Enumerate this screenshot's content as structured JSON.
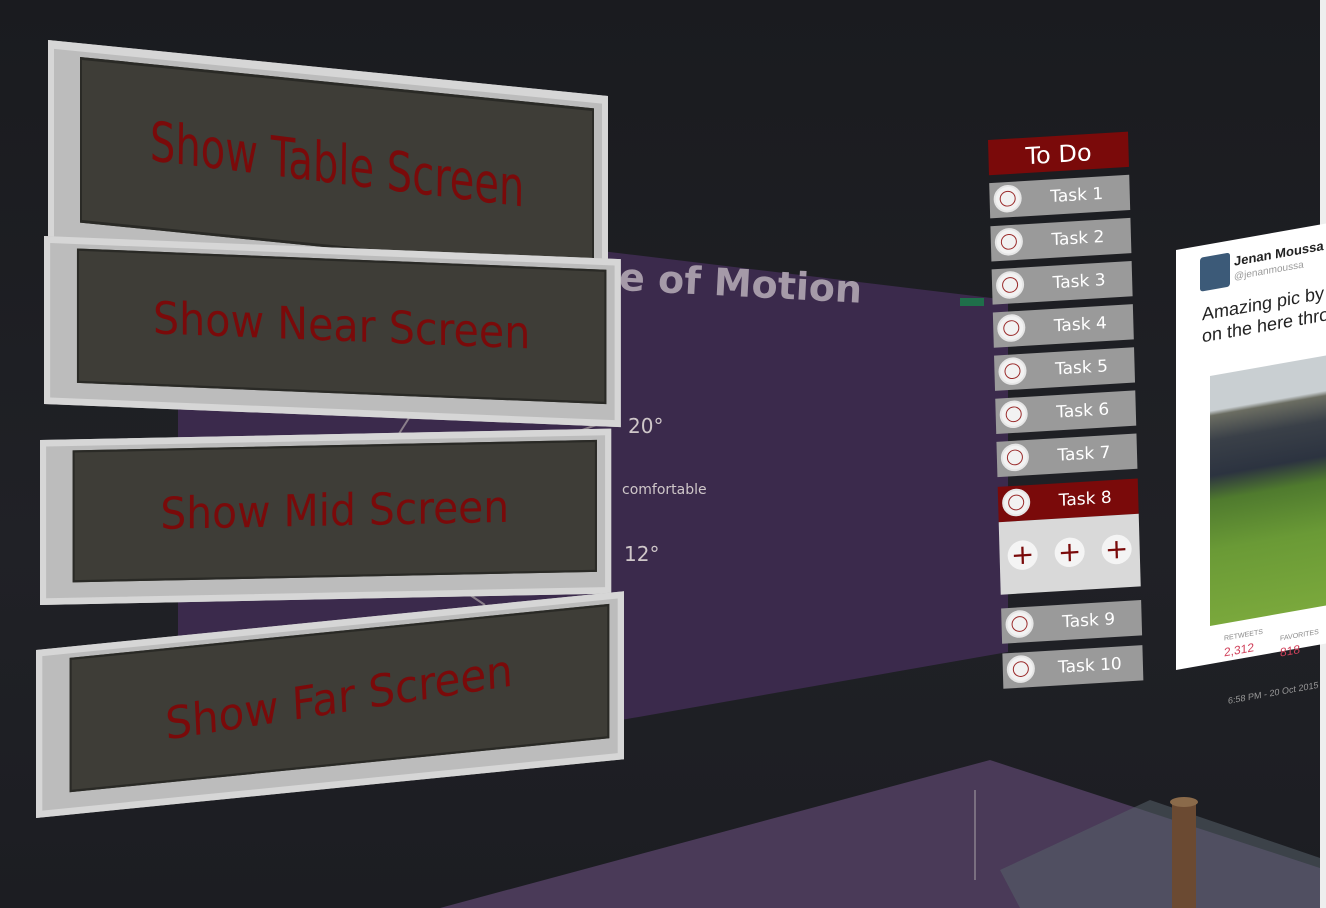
{
  "menu": {
    "table": "Show Table Screen",
    "near": "Show Near Screen",
    "mid": "Show Mid Screen",
    "far": "Show Far Screen"
  },
  "slide": {
    "title": "Range of Motion",
    "angle_top": "20°",
    "comfort": "comfortable",
    "angle_bottom": "12°"
  },
  "todo": {
    "title": "To Do",
    "tasks": [
      "Task 1",
      "Task 2",
      "Task 3",
      "Task 4",
      "Task 5",
      "Task 6",
      "Task 7",
      "Task 8",
      "Task 9",
      "Task 10"
    ],
    "plus": "+"
  },
  "tweet": {
    "name": "Jenan Moussa",
    "handle": "@jenanmoussa",
    "text": "Amazing pic by migrants on the here through S",
    "retweets_label": "RETWEETS",
    "retweets": "2,312",
    "favorites_label": "FAVORITES",
    "favorites": "818",
    "time": "6:58 PM - 20 Oct 2015"
  },
  "colors": {
    "accent": "#7a0a0a",
    "panel": "#3e3d37",
    "slide": "#3b2a4c"
  }
}
